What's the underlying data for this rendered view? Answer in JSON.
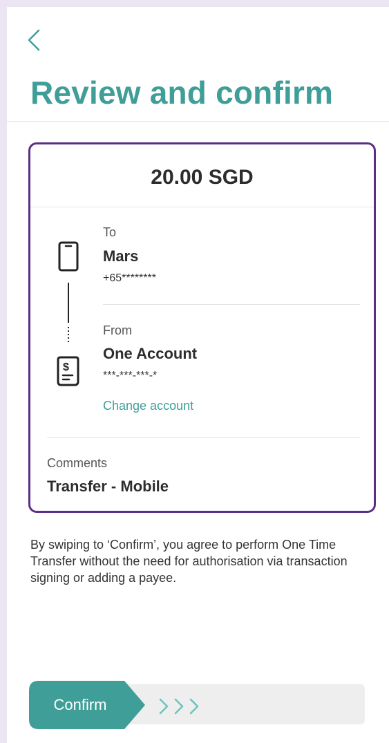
{
  "header": {
    "title": "Review and confirm"
  },
  "transfer": {
    "amount": "20.00 SGD",
    "to": {
      "label": "To",
      "name": "Mars",
      "number": "+65********"
    },
    "from": {
      "label": "From",
      "name": "One Account",
      "number": "***-***-***-*",
      "change_link": "Change account"
    },
    "comments": {
      "label": "Comments",
      "value": "Transfer - Mobile"
    }
  },
  "disclaimer": "By swiping to ‘Confirm’, you agree to perform One Time Transfer without the need for authorisation via transaction signing or adding a payee.",
  "swipe": {
    "label": "Confirm"
  },
  "icons": {
    "back": "chevron-left-icon",
    "phone": "mobile-phone-icon",
    "account": "account-document-icon",
    "swipe_hint": "triple-chevron-right-icon"
  },
  "colors": {
    "accent": "#3f9e98",
    "card_border": "#5b2f86",
    "chevron": "#6cc4bd"
  }
}
